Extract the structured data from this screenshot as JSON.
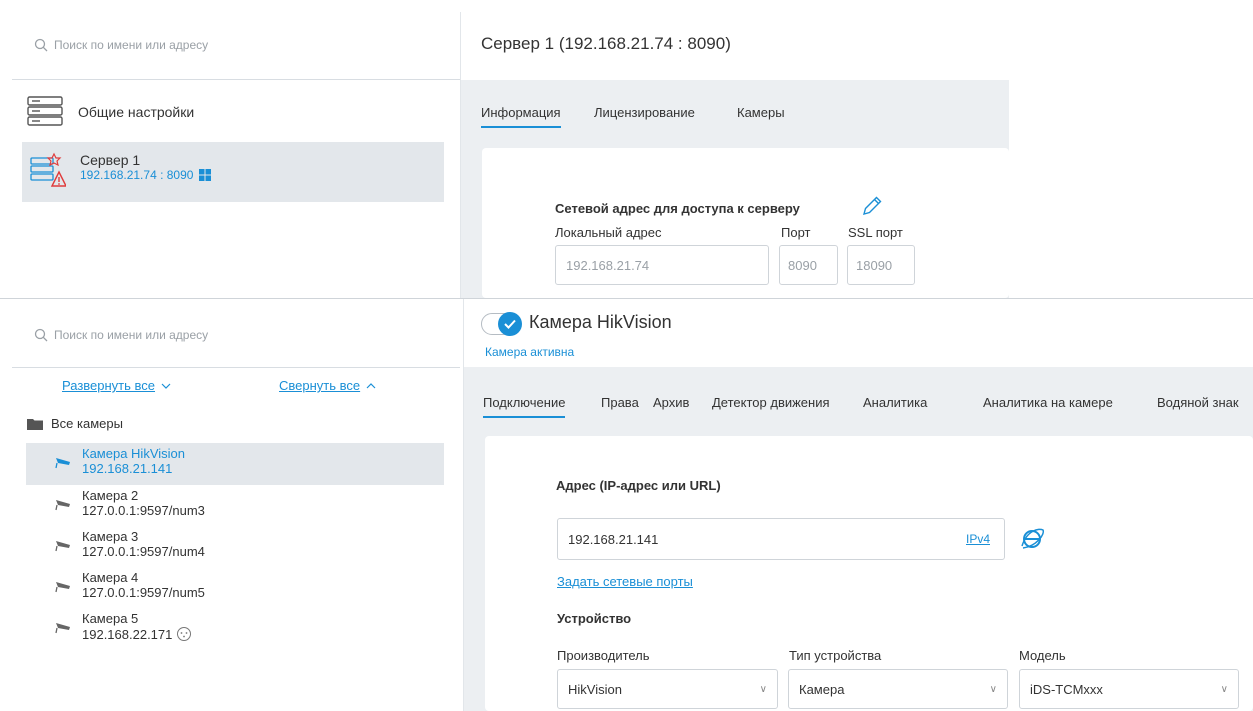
{
  "top": {
    "search_placeholder": "Поиск по имени или адресу",
    "server_title": "Сервер 1 (192.168.21.74 : 8090)",
    "sidebar": {
      "general_settings": "Общие настройки",
      "server_name": "Сервер 1",
      "server_address": "192.168.21.74 : 8090"
    },
    "tabs": [
      "Информация",
      "Лицензирование",
      "Камеры"
    ],
    "network": {
      "heading": "Сетевой адрес для доступа к серверу",
      "local_label": "Локальный адрес",
      "port_label": "Порт",
      "ssl_label": "SSL порт",
      "local_value": "192.168.21.74",
      "port_value": "8090",
      "ssl_value": "18090"
    }
  },
  "bottom": {
    "search_placeholder": "Поиск по имени или адресу",
    "expand_all": "Развернуть все",
    "collapse_all": "Свернуть все",
    "all_cameras": "Все камеры",
    "cameras": [
      {
        "name": "Камера HikVision",
        "address": "192.168.21.141"
      },
      {
        "name": "Камера 2",
        "address": "127.0.0.1:9597/num3"
      },
      {
        "name": "Камера 3",
        "address": "127.0.0.1:9597/num4"
      },
      {
        "name": "Камера 4",
        "address": "127.0.0.1:9597/num5"
      },
      {
        "name": "Камера 5",
        "address": "192.168.22.171"
      }
    ],
    "camera_title": "Камера HikVision",
    "camera_status": "Камера активна",
    "tabs": [
      "Подключение",
      "Права",
      "Архив",
      "Детектор движения",
      "Аналитика",
      "Аналитика на камере",
      "Водяной знак"
    ],
    "address_heading": "Адрес (IP-адрес или URL)",
    "address_value": "192.168.21.141",
    "ipv_link": "IPv4",
    "set_ports_link": "Задать сетевые порты",
    "device_heading": "Устройство",
    "manufacturer_label": "Производитель",
    "device_type_label": "Тип устройства",
    "model_label": "Модель",
    "manufacturer_value": "HikVision",
    "device_type_value": "Камера",
    "model_value": "iDS-TCMxxx"
  },
  "colors": {
    "accent": "#1a8fd6",
    "selected_bg": "#e3e7eb",
    "panel_bg": "#eceff2",
    "warning": "#e03c3c"
  }
}
